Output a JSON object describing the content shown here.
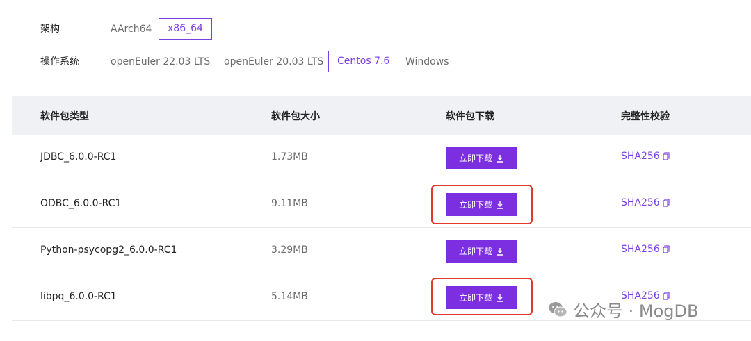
{
  "filters": {
    "arch": {
      "label": "架构",
      "options": [
        "AArch64",
        "x86_64"
      ],
      "selected": "x86_64"
    },
    "os": {
      "label": "操作系统",
      "options": [
        "openEuler 22.03 LTS",
        "openEuler 20.03 LTS",
        "Centos 7.6",
        "Windows"
      ],
      "selected": "Centos 7.6"
    }
  },
  "table": {
    "headers": [
      "软件包类型",
      "软件包大小",
      "软件包下载",
      "完整性校验"
    ],
    "rows": [
      {
        "name": "JDBC_6.0.0-RC1",
        "size": "1.73MB",
        "download": "立即下载",
        "checksum": "SHA256"
      },
      {
        "name": "ODBC_6.0.0-RC1",
        "size": "9.11MB",
        "download": "立即下载",
        "checksum": "SHA256"
      },
      {
        "name": "Python-psycopg2_6.0.0-RC1",
        "size": "3.29MB",
        "download": "立即下载",
        "checksum": "SHA256"
      },
      {
        "name": "libpq_6.0.0-RC1",
        "size": "5.14MB",
        "download": "立即下载",
        "checksum": "SHA256"
      }
    ]
  },
  "watermark": {
    "text": "公众号 · MogDB",
    "icon": "wechat-icon"
  },
  "colors": {
    "accent": "#7b2fe0",
    "highlight": "#e23a2a"
  }
}
